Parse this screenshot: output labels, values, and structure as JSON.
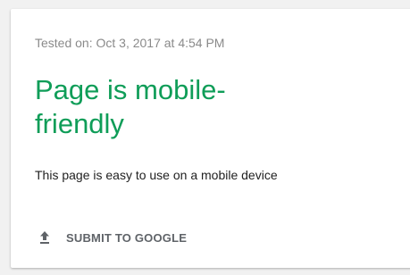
{
  "result_card": {
    "tested_on": "Tested on: Oct 3, 2017 at 4:54 PM",
    "title": "Page is mobile-friendly",
    "description": "This page is easy to use on a mobile device",
    "submit_button": {
      "label": "SUBMIT TO GOOGLE",
      "icon": "upload-icon"
    }
  },
  "colors": {
    "title_green": "#0f9d58",
    "tested_gray": "#8a8a8a",
    "button_gray": "#5f6368"
  }
}
